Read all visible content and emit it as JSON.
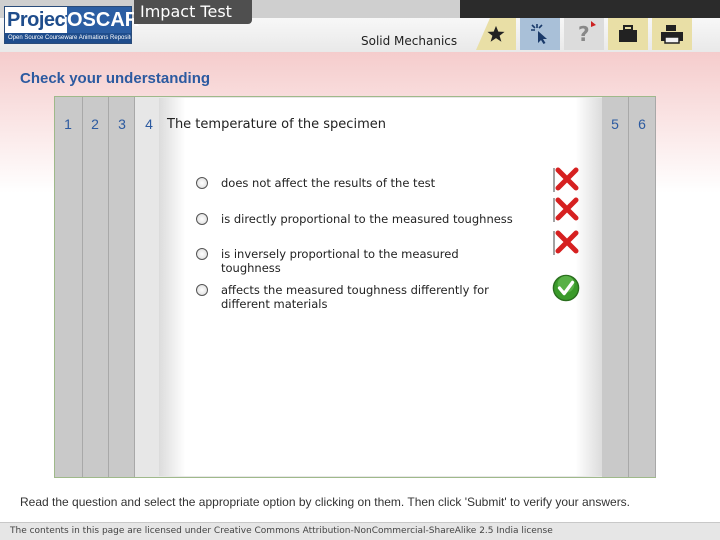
{
  "header": {
    "logo_main": "Project",
    "logo_brand": "OSCAR",
    "logo_subtitle": "Open Source Courseware Animations Repository",
    "title": "Impact Test",
    "subject": "Solid Mechanics",
    "toolbar": [
      {
        "icon": "star-icon"
      },
      {
        "icon": "cursor-click-icon"
      },
      {
        "icon": "help-icon",
        "label": "?"
      },
      {
        "icon": "briefcase-icon"
      },
      {
        "icon": "printer-icon"
      }
    ]
  },
  "section": {
    "heading": "Check your understanding"
  },
  "quiz": {
    "questions_left": [
      "1",
      "2",
      "3",
      "4"
    ],
    "questions_right": [
      "5",
      "6"
    ],
    "current_question": "4",
    "question_text": "The temperature of the specimen",
    "options": [
      {
        "text": "does not affect the results of the test",
        "result": "wrong"
      },
      {
        "text": "is directly proportional to the measured toughness",
        "result": "wrong"
      },
      {
        "text": "is inversely proportional to the measured toughness",
        "result": "wrong"
      },
      {
        "text": "affects the measured toughness differently for different materials",
        "result": "correct"
      }
    ],
    "colors": {
      "wrong": "#d62020",
      "correct": "#3a9a2a",
      "accent": "#2c5aa0"
    }
  },
  "instructions": "Read the question and select the appropriate option by clicking on them. Then click 'Submit' to verify your answers.",
  "footer": {
    "license": "The contents in this page are licensed under Creative Commons Attribution-NonCommercial-ShareAlike 2.5 India license"
  }
}
